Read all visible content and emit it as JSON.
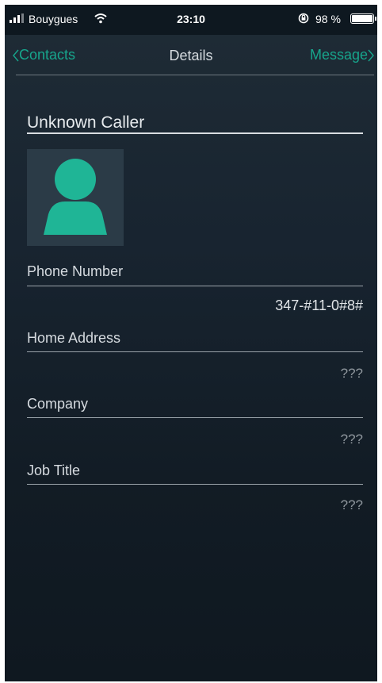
{
  "status_bar": {
    "carrier": "Bouygues",
    "time": "23:10",
    "battery": "98 %"
  },
  "nav": {
    "back_label": "Contacts",
    "title": "Details",
    "action_label": "Message"
  },
  "contact": {
    "name": "Unknown Caller",
    "fields": [
      {
        "label": "Phone Number",
        "value": "347-#11-0#8#"
      },
      {
        "label": "Home Address",
        "value": "???"
      },
      {
        "label": "Company",
        "value": "???"
      },
      {
        "label": "Job Title",
        "value": "???"
      }
    ]
  },
  "colors": {
    "accent": "#17a58c",
    "background": "#182430"
  },
  "icons": {
    "wifi": "wifi-icon",
    "lock": "rotation-lock-icon",
    "avatar": "person-silhouette-icon"
  }
}
